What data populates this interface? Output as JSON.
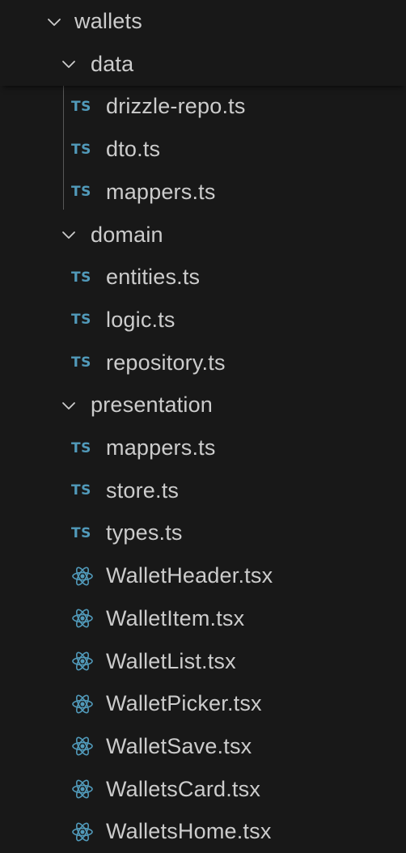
{
  "explorer": {
    "root": {
      "label": "wallets",
      "expanded": true
    },
    "groups": [
      {
        "label": "data",
        "expanded": true,
        "files": [
          {
            "name": "drizzle-repo.ts",
            "icon": "typescript-icon",
            "icon_text": "TS"
          },
          {
            "name": "dto.ts",
            "icon": "typescript-icon",
            "icon_text": "TS"
          },
          {
            "name": "mappers.ts",
            "icon": "typescript-icon",
            "icon_text": "TS"
          }
        ]
      },
      {
        "label": "domain",
        "expanded": true,
        "files": [
          {
            "name": "entities.ts",
            "icon": "typescript-icon",
            "icon_text": "TS"
          },
          {
            "name": "logic.ts",
            "icon": "typescript-icon",
            "icon_text": "TS"
          },
          {
            "name": "repository.ts",
            "icon": "typescript-icon",
            "icon_text": "TS"
          }
        ]
      },
      {
        "label": "presentation",
        "expanded": true,
        "files": [
          {
            "name": "mappers.ts",
            "icon": "typescript-icon",
            "icon_text": "TS"
          },
          {
            "name": "store.ts",
            "icon": "typescript-icon",
            "icon_text": "TS"
          },
          {
            "name": "types.ts",
            "icon": "typescript-icon",
            "icon_text": "TS"
          },
          {
            "name": "WalletHeader.tsx",
            "icon": "react-icon"
          },
          {
            "name": "WalletItem.tsx",
            "icon": "react-icon"
          },
          {
            "name": "WalletList.tsx",
            "icon": "react-icon"
          },
          {
            "name": "WalletPicker.tsx",
            "icon": "react-icon"
          },
          {
            "name": "WalletSave.tsx",
            "icon": "react-icon"
          },
          {
            "name": "WalletsCard.tsx",
            "icon": "react-icon"
          },
          {
            "name": "WalletsHome.tsx",
            "icon": "react-icon"
          }
        ]
      }
    ]
  },
  "colors": {
    "background": "#181818",
    "text": "#cccccc",
    "typescript_icon": "#519aba",
    "react_icon": "#519aba",
    "indent_guide": "#585858"
  }
}
